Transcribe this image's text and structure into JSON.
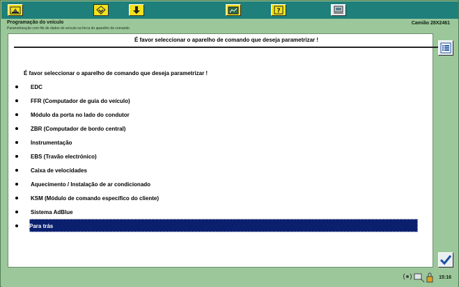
{
  "toolbar": {
    "buttons": [
      {
        "icon": "home-icon"
      },
      {
        "icon": "diagnosis-icon"
      },
      {
        "icon": "download-icon"
      },
      {
        "icon": "chart-icon"
      },
      {
        "icon": "help-icon"
      },
      {
        "icon": "computer-icon"
      }
    ]
  },
  "header": {
    "title": "Programação do veículo",
    "subtitle": "Parametrização com file de dados do veículo na forca do aparelho de comando",
    "vehicle": "Camião 28X2461"
  },
  "panel": {
    "heading": "É favor seleccionar o aparelho de comando que deseja parametrizar !",
    "prompt": "É favor seleccionar o aparelho de comando que deseja parametrizar !",
    "items": [
      {
        "label": "EDC"
      },
      {
        "label": "FFR (Computador de guia do veículo)"
      },
      {
        "label": "Módulo da porta no lado do condutor"
      },
      {
        "label": "ZBR (Computador de bordo central)"
      },
      {
        "label": "Instrumentação"
      },
      {
        "label": "EBS (Travão electrónico)"
      },
      {
        "label": "Caixa de velocidades"
      },
      {
        "label": "Aquecimento / Instalação de ar condicionado"
      },
      {
        "label": "KSM (Módulo de comando específico do cliente)"
      },
      {
        "label": "Sistema AdBlue"
      },
      {
        "label": "Para trás",
        "selected": true
      }
    ]
  },
  "status": {
    "time": "15:16"
  },
  "colors": {
    "toolbar_bg": "#1f7f7a",
    "frame_bg": "#9cc79b",
    "selection_bg": "#0a1f6e",
    "button_yellow": "#f2e21c"
  }
}
